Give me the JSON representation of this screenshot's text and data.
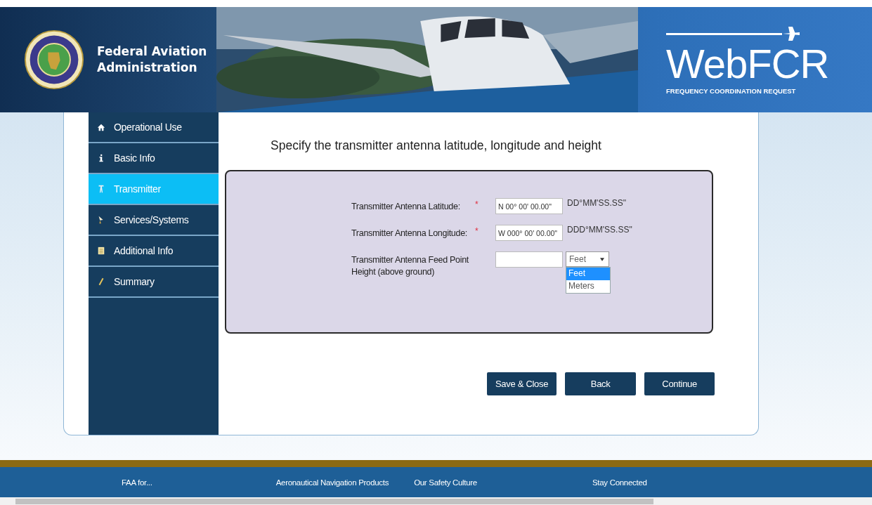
{
  "header": {
    "org_lines": [
      "Federal Aviation",
      "Administration"
    ],
    "product_name": "WebFCR",
    "product_tagline": "FREQUENCY COORDINATION REQUEST"
  },
  "sidebar": {
    "items": [
      {
        "label": "Operational Use",
        "selected": false
      },
      {
        "label": "Basic Info",
        "selected": false
      },
      {
        "label": "Transmitter",
        "selected": true
      },
      {
        "label": "Services/Systems",
        "selected": false
      },
      {
        "label": "Additional Info",
        "selected": false
      },
      {
        "label": "Summary",
        "selected": false
      }
    ]
  },
  "content": {
    "heading": "Specify the transmitter antenna latitude, longitude and height",
    "fields": [
      {
        "kind": "text",
        "label": "Transmitter Antenna Latitude:",
        "required_mark": "*",
        "value": "N 00° 00' 00.00\"",
        "format": "DD°MM'SS.SS\""
      },
      {
        "kind": "text",
        "label": "Transmitter Antenna Longitude:",
        "required_mark": "*",
        "value": "W 000° 00' 00.00\"",
        "format": "DDD°MM'SS.SS\""
      },
      {
        "kind": "height",
        "label": "Transmitter Antenna Feed Point Height (above ground)",
        "unit_select": {
          "value": "Feet",
          "expanded": true,
          "options": [
            {
              "label": "Feet",
              "selected": true
            },
            {
              "label": "Meters",
              "selected": false
            }
          ]
        }
      }
    ],
    "buttons": [
      "Save & Close",
      "Back",
      "Continue"
    ]
  },
  "footer": {
    "links": [
      "FAA for...",
      "Aeronautical Navigation Products",
      "Our Safety Culture",
      "Stay Connected"
    ]
  }
}
